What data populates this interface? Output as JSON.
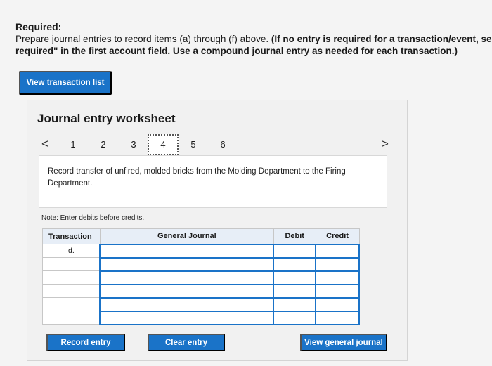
{
  "instructions": {
    "title": "Required:",
    "text_plain": "Prepare journal entries to record items (a) through (f) above. ",
    "text_bold_1": "(If no entry is required for a transaction/event, select",
    "text_bold_2": "required\" in the first account field. Use a compound journal entry as needed for each transaction.)"
  },
  "buttons": {
    "view_transaction_list": "View transaction list",
    "record_entry": "Record entry",
    "clear_entry": "Clear entry",
    "view_general_journal": "View general journal"
  },
  "worksheet": {
    "title": "Journal entry worksheet",
    "nav": {
      "prev": "<",
      "next": ">",
      "pages": [
        "1",
        "2",
        "3",
        "4",
        "5",
        "6"
      ],
      "active_page": "4"
    },
    "description": "Record transfer of unfired, molded bricks from the Molding Department to the Firing Department.",
    "note": "Note: Enter debits before credits.",
    "table": {
      "headers": [
        "Transaction",
        "General Journal",
        "Debit",
        "Credit"
      ],
      "rows": [
        {
          "transaction": "d.",
          "account": "",
          "debit": "",
          "credit": ""
        },
        {
          "transaction": "",
          "account": "",
          "debit": "",
          "credit": ""
        },
        {
          "transaction": "",
          "account": "",
          "debit": "",
          "credit": ""
        },
        {
          "transaction": "",
          "account": "",
          "debit": "",
          "credit": ""
        },
        {
          "transaction": "",
          "account": "",
          "debit": "",
          "credit": ""
        },
        {
          "transaction": "",
          "account": "",
          "debit": "",
          "credit": ""
        }
      ]
    }
  },
  "colors": {
    "accent": "#1a73c8",
    "header_bg": "#e7eef7"
  }
}
